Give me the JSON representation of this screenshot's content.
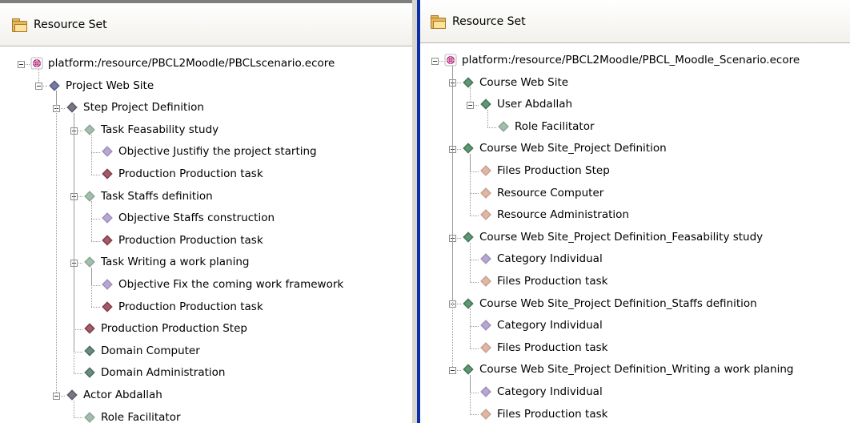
{
  "colors": {
    "left_border": "#7f7f80",
    "right_border": "#0a2fa6",
    "root_icon": "#a0106a",
    "blue_gray_diamond": "#5a5e8a",
    "dark_gray_diamond": "#5b5b6b",
    "green_diamond": "#3f7e56",
    "light_green_diamond": "#8fb09a",
    "purple_diamond": "#a894c8",
    "red_diamond": "#8c3a48",
    "peach_diamond": "#d8a890",
    "dark_teal_diamond": "#4a7268"
  },
  "left_panel": {
    "header": {
      "icon": "resource-set-folder-icon",
      "title": "Resource Set"
    },
    "tree": [
      {
        "depth": 0,
        "expanded": true,
        "icon": "model-resource-icon",
        "color": "root",
        "label": "platform:/resource/PBCL2Moodle/PBCLscenario.ecore"
      },
      {
        "depth": 1,
        "expanded": true,
        "icon": "diamond-icon",
        "color": "blue_gray",
        "label": "Project Web Site"
      },
      {
        "depth": 2,
        "expanded": true,
        "icon": "diamond-icon",
        "color": "dark_gray",
        "label": "Step Project Definition"
      },
      {
        "depth": 3,
        "expanded": true,
        "icon": "diamond-icon",
        "color": "light_green",
        "label": "Task Feasability study"
      },
      {
        "depth": 4,
        "expanded": null,
        "icon": "diamond-icon",
        "color": "purple",
        "label": "Objective Justifiy the project starting"
      },
      {
        "depth": 4,
        "expanded": null,
        "icon": "diamond-icon",
        "color": "red",
        "label": "Production Production task"
      },
      {
        "depth": 3,
        "expanded": true,
        "icon": "diamond-icon",
        "color": "light_green",
        "label": "Task Staffs definition"
      },
      {
        "depth": 4,
        "expanded": null,
        "icon": "diamond-icon",
        "color": "purple",
        "label": "Objective Staffs construction"
      },
      {
        "depth": 4,
        "expanded": null,
        "icon": "diamond-icon",
        "color": "red",
        "label": "Production Production task"
      },
      {
        "depth": 3,
        "expanded": true,
        "icon": "diamond-icon",
        "color": "light_green",
        "label": "Task Writing a work planing"
      },
      {
        "depth": 4,
        "expanded": null,
        "icon": "diamond-icon",
        "color": "purple",
        "label": "Objective Fix the coming work framework"
      },
      {
        "depth": 4,
        "expanded": null,
        "icon": "diamond-icon",
        "color": "red",
        "label": "Production Production task"
      },
      {
        "depth": 3,
        "expanded": null,
        "icon": "diamond-icon",
        "color": "red",
        "label": "Production Production Step"
      },
      {
        "depth": 3,
        "expanded": null,
        "icon": "diamond-icon",
        "color": "dark_teal",
        "label": "Domain Computer"
      },
      {
        "depth": 3,
        "expanded": null,
        "icon": "diamond-icon",
        "color": "dark_teal",
        "label": "Domain Administration"
      },
      {
        "depth": 2,
        "expanded": true,
        "icon": "diamond-icon",
        "color": "dark_gray",
        "label": "Actor Abdallah"
      },
      {
        "depth": 3,
        "expanded": null,
        "icon": "diamond-icon",
        "color": "light_green",
        "label": "Role Facilitator"
      }
    ]
  },
  "right_panel": {
    "header": {
      "icon": "resource-set-folder-icon",
      "title": "Resource Set"
    },
    "tree": [
      {
        "depth": 0,
        "expanded": true,
        "icon": "model-resource-icon",
        "color": "root",
        "label": "platform:/resource/PBCL2Moodle/PBCL_Moodle_Scenario.ecore"
      },
      {
        "depth": 1,
        "expanded": true,
        "icon": "diamond-icon",
        "color": "green",
        "label": "Course Web Site"
      },
      {
        "depth": 2,
        "expanded": true,
        "icon": "diamond-icon",
        "color": "green",
        "label": "User Abdallah"
      },
      {
        "depth": 3,
        "expanded": null,
        "icon": "diamond-icon",
        "color": "light_green",
        "label": "Role Facilitator"
      },
      {
        "depth": 1,
        "expanded": true,
        "icon": "diamond-icon",
        "color": "green",
        "label": "Course Web Site_Project Definition"
      },
      {
        "depth": 2,
        "expanded": null,
        "icon": "diamond-icon",
        "color": "peach",
        "label": "Files Production Step"
      },
      {
        "depth": 2,
        "expanded": null,
        "icon": "diamond-icon",
        "color": "peach",
        "label": "Resource Computer"
      },
      {
        "depth": 2,
        "expanded": null,
        "icon": "diamond-icon",
        "color": "peach",
        "label": "Resource Administration"
      },
      {
        "depth": 1,
        "expanded": true,
        "icon": "diamond-icon",
        "color": "green",
        "label": "Course Web Site_Project Definition_Feasability study"
      },
      {
        "depth": 2,
        "expanded": null,
        "icon": "diamond-icon",
        "color": "purple",
        "label": "Category Individual"
      },
      {
        "depth": 2,
        "expanded": null,
        "icon": "diamond-icon",
        "color": "peach",
        "label": "Files Production task"
      },
      {
        "depth": 1,
        "expanded": true,
        "icon": "diamond-icon",
        "color": "green",
        "label": "Course Web Site_Project Definition_Staffs definition"
      },
      {
        "depth": 2,
        "expanded": null,
        "icon": "diamond-icon",
        "color": "purple",
        "label": "Category Individual"
      },
      {
        "depth": 2,
        "expanded": null,
        "icon": "diamond-icon",
        "color": "peach",
        "label": "Files Production task"
      },
      {
        "depth": 1,
        "expanded": true,
        "icon": "diamond-icon",
        "color": "green",
        "label": "Course Web Site_Project Definition_Writing a work planing"
      },
      {
        "depth": 2,
        "expanded": null,
        "icon": "diamond-icon",
        "color": "purple",
        "label": "Category Individual"
      },
      {
        "depth": 2,
        "expanded": null,
        "icon": "diamond-icon",
        "color": "peach",
        "label": "Files Production task"
      }
    ]
  }
}
